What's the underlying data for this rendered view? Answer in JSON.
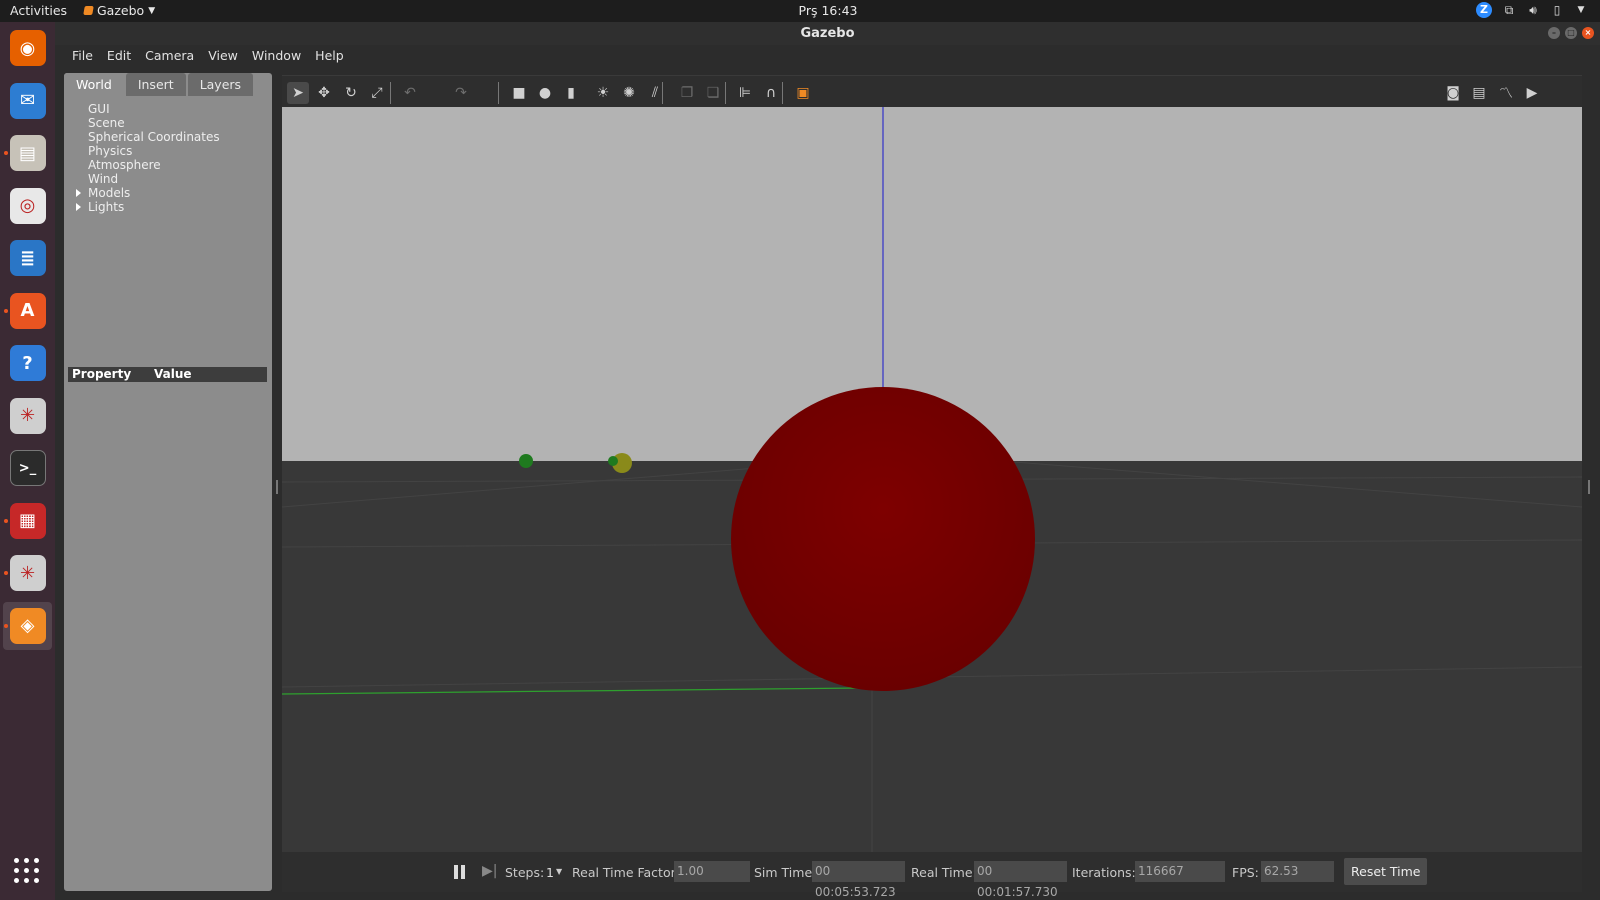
{
  "topbar": {
    "activities": "Activities",
    "app_name": "Gazebo",
    "clock": "Prş 16:43",
    "tray_icons": [
      "zoom-icon",
      "network-icon",
      "volume-icon",
      "battery-icon",
      "system-menu-arrow-icon"
    ]
  },
  "dock": {
    "items": [
      {
        "name": "firefox-icon",
        "color": "#e66000",
        "running": false
      },
      {
        "name": "thunderbird-icon",
        "color": "#2d7dd2",
        "running": false
      },
      {
        "name": "files-icon",
        "color": "#c7c2b8",
        "running": true
      },
      {
        "name": "rhythmbox-icon",
        "color": "#e8e8e8",
        "running": false
      },
      {
        "name": "libreoffice-writer-icon",
        "color": "#2a76c6",
        "running": false
      },
      {
        "name": "ubuntu-software-icon",
        "color": "#e95420",
        "running": true
      },
      {
        "name": "help-icon",
        "color": "#2f7bd7",
        "running": false
      },
      {
        "name": "ros-rviz-icon",
        "color": "#cfcfcf",
        "running": false
      },
      {
        "name": "terminal-icon",
        "color": "#2b2b2b",
        "running": false
      },
      {
        "name": "red-app-icon",
        "color": "#c62828",
        "running": true
      },
      {
        "name": "ros-rviz-2-icon",
        "color": "#cfcfcf",
        "running": true
      },
      {
        "name": "gazebo-icon",
        "color": "#f08a24",
        "running": true
      }
    ],
    "show_apps_icon": "apps-grid-icon"
  },
  "window": {
    "title": "Gazebo",
    "menu": [
      "File",
      "Edit",
      "Camera",
      "View",
      "Window",
      "Help"
    ]
  },
  "left_panel": {
    "tabs": [
      "World",
      "Insert",
      "Layers"
    ],
    "active_tab": "World",
    "tree": [
      {
        "label": "GUI",
        "expandable": false
      },
      {
        "label": "Scene",
        "expandable": false
      },
      {
        "label": "Spherical Coordinates",
        "expandable": false
      },
      {
        "label": "Physics",
        "expandable": false
      },
      {
        "label": "Atmosphere",
        "expandable": false
      },
      {
        "label": "Wind",
        "expandable": false
      },
      {
        "label": "Models",
        "expandable": true
      },
      {
        "label": "Lights",
        "expandable": true
      }
    ],
    "property_header": {
      "property": "Property",
      "value": "Value"
    }
  },
  "toolbar": {
    "tools": [
      "select-arrow-icon",
      "translate-icon",
      "rotate-icon",
      "scale-icon",
      "undo-icon",
      "redo-icon",
      "box-shape-icon",
      "sphere-shape-icon",
      "cylinder-shape-icon",
      "point-light-icon",
      "spot-light-icon",
      "directional-light-icon",
      "copy-icon",
      "paste-icon",
      "align-icon",
      "snap-icon",
      "view-angle-icon",
      "screenshot-icon",
      "log-icon",
      "plot-icon",
      "video-record-icon"
    ]
  },
  "scene": {
    "sky_color": "#b3b3b3",
    "ground_color": "#383838",
    "sphere_color": "#7a0000",
    "axis_z_color": "#3232c8",
    "axis_y_color": "#2ea02e"
  },
  "statusbar": {
    "steps_label": "Steps:",
    "steps_value": "1",
    "rtf_label": "Real Time Factor:",
    "rtf_value": "1.00",
    "sim_time_label": "Sim Time:",
    "sim_time_value": "00 00:05:53.723",
    "real_time_label": "Real Time:",
    "real_time_value": "00 00:01:57.730",
    "iterations_label": "Iterations:",
    "iterations_value": "116667",
    "fps_label": "FPS:",
    "fps_value": "62.53",
    "reset_button": "Reset Time"
  }
}
